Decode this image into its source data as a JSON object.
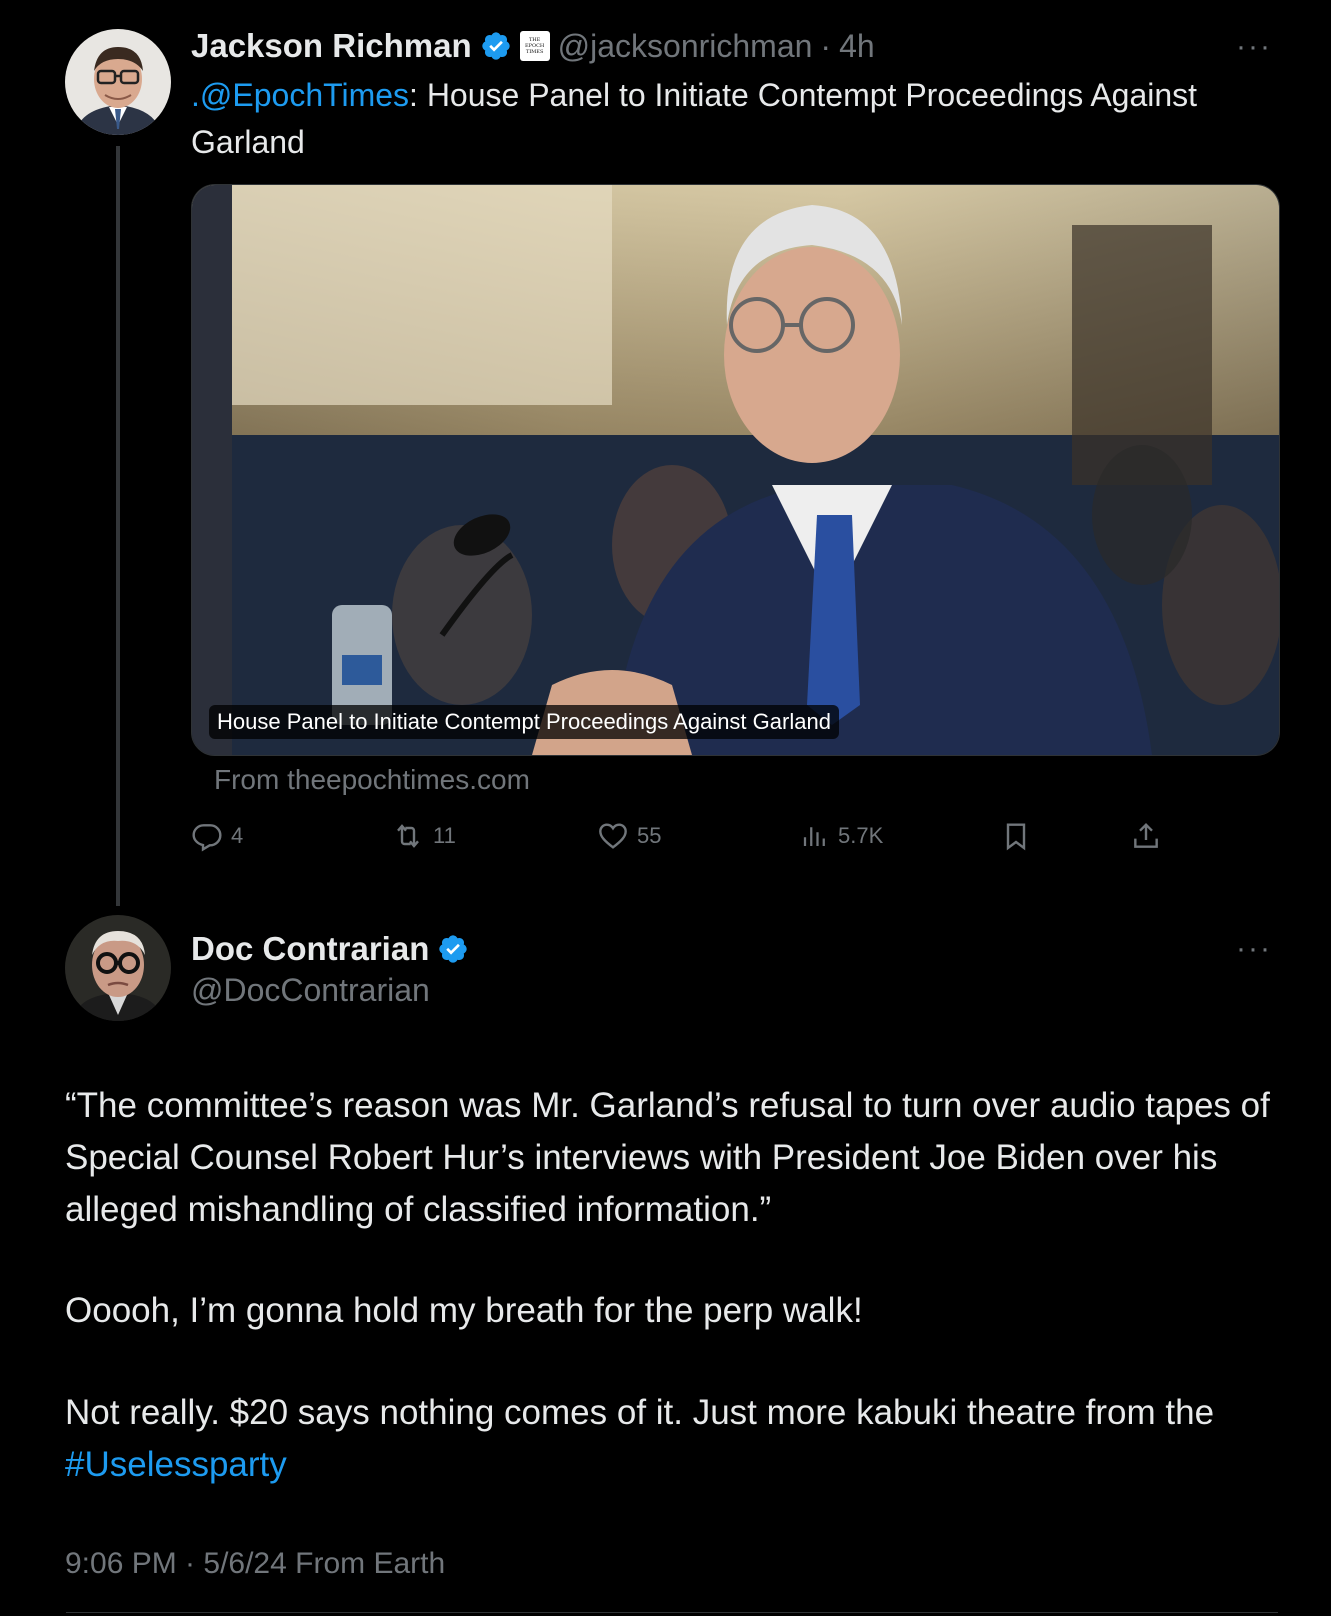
{
  "parent_tweet": {
    "author_name": "Jackson Richman",
    "handle": "@jacksonrichman",
    "separator": "·",
    "time": "4h",
    "affiliation_badge_text": "THE EPOCH TIMES",
    "more_label": "···",
    "text_mention": ".@EpochTimes",
    "text_rest": ": House Panel to Initiate Contempt Proceedings Against Garland",
    "card": {
      "caption": "House Panel to Initiate Contempt Proceedings Against Garland",
      "from": "From theepochtimes.com"
    },
    "actions": {
      "replies": "4",
      "reposts": "11",
      "likes": "55",
      "views": "5.7K"
    }
  },
  "main_tweet": {
    "author_name": "Doc Contrarian",
    "handle": "@DocContrarian",
    "more_label": "···",
    "paragraph1": "“The committee’s reason was Mr. Garland’s refusal to turn over audio tapes of Special Counsel Robert Hur’s interviews with President Joe Biden over his alleged mishandling of classified information.”",
    "paragraph2": "Ooooh, I’m gonna hold my breath for the perp walk!",
    "paragraph3_text": "Not really. $20 says nothing comes of it. Just more kabuki theatre from the ",
    "paragraph3_hashtag": "#Uselessparty",
    "timestamp": "9:06 PM · 5/6/24 From Earth"
  },
  "colors": {
    "background": "#000000",
    "text": "#e7e9ea",
    "secondary": "#71767b",
    "link": "#1d9bf0",
    "verified": "#1d9bf0"
  },
  "icons": [
    "reply-icon",
    "repost-icon",
    "like-icon",
    "views-icon",
    "bookmark-icon",
    "share-icon",
    "verified-icon",
    "more-icon"
  ]
}
